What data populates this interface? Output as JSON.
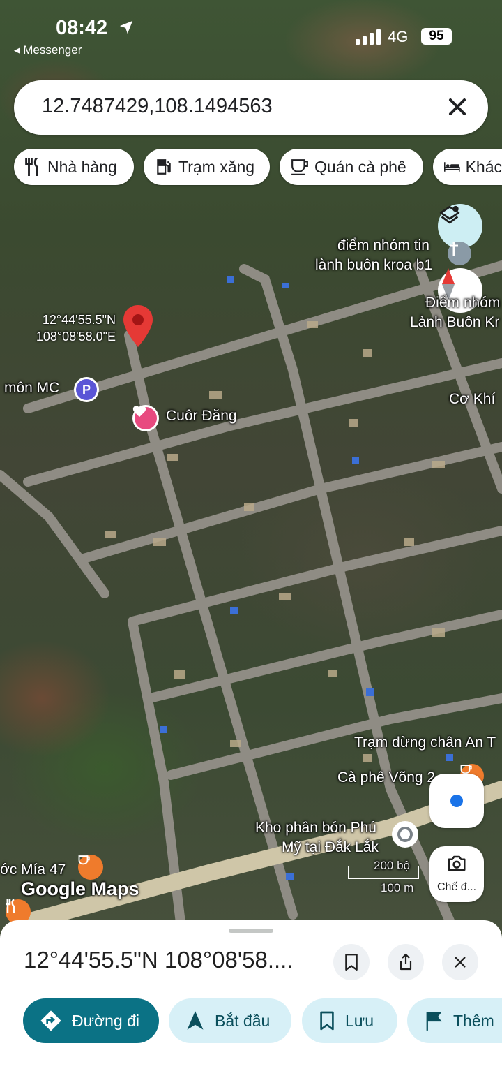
{
  "status_bar": {
    "time": "08:42",
    "back_app": "◂ Messenger",
    "network": "4G",
    "battery": "95"
  },
  "search": {
    "query": "12.7487429,108.1494563"
  },
  "chips": [
    {
      "label": "Nhà hàng",
      "icon": "restaurant-icon"
    },
    {
      "label": "Trạm xăng",
      "icon": "gas-station-icon"
    },
    {
      "label": "Quán cà phê",
      "icon": "coffee-icon"
    },
    {
      "label": "Khác",
      "icon": "hotel-icon"
    }
  ],
  "map": {
    "dropped_pin": {
      "lat": "12°44'55.5\"N",
      "lng": "108°08'58.0\"E"
    },
    "labels": {
      "church1_l1": "điểm nhóm tin",
      "church1_l2": "lành buôn kroa b1",
      "church2_l1": "Điểm nhóm",
      "church2_l2": "Lành Buôn Kr",
      "parking": "môn MC",
      "favorite": "Cuôr Đăng",
      "shop": "Cơ Khí",
      "stop": "Trạm dừng chân An T",
      "cafe": "Cà phê Võng 2",
      "fertilizer_l1": "Kho phân bón Phú",
      "fertilizer_l2": "Mỹ tại Đắk Lắk",
      "sugarcane": "ớc Mía 47",
      "brand": "Google Maps",
      "scale_ft": "200 bộ",
      "scale_m": "100 m"
    },
    "camera_label": "Chế đ..."
  },
  "sheet": {
    "title": "12°44'55.5\"N 108°08'58....",
    "actions": [
      {
        "label": "Đường đi",
        "icon": "directions-icon"
      },
      {
        "label": "Bắt đầu",
        "icon": "navigation-arrow-icon"
      },
      {
        "label": "Lưu",
        "icon": "bookmark-icon"
      },
      {
        "label": "Thêm",
        "icon": "flag-icon"
      }
    ]
  },
  "colors": {
    "accent": "#0b7285",
    "action_bg": "#d7f0f7",
    "pin_red": "#e53935",
    "blue_dot": "#1a73e8"
  }
}
